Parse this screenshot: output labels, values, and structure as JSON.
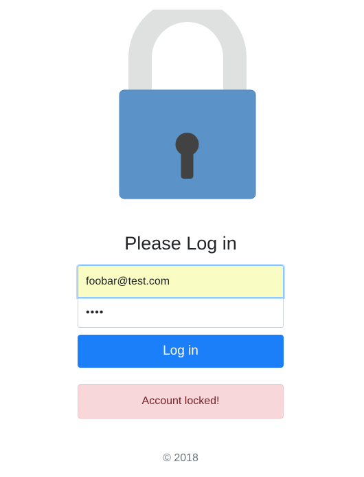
{
  "logo": {
    "icon": "padlock-icon",
    "shackle_color": "#dfe1e0",
    "body_color": "#5b93c8",
    "keyhole_color": "#424242"
  },
  "page": {
    "title": "Please Log in"
  },
  "form": {
    "email_value": "foobar@test.com",
    "password_value": "••••",
    "login_label": "Log in"
  },
  "alert": {
    "message": "Account locked!",
    "color": "#f8d7da"
  },
  "footer": {
    "text": "© 2018"
  },
  "colors": {
    "primary": "#1a7ff9",
    "autofill": "#fafdc3"
  }
}
